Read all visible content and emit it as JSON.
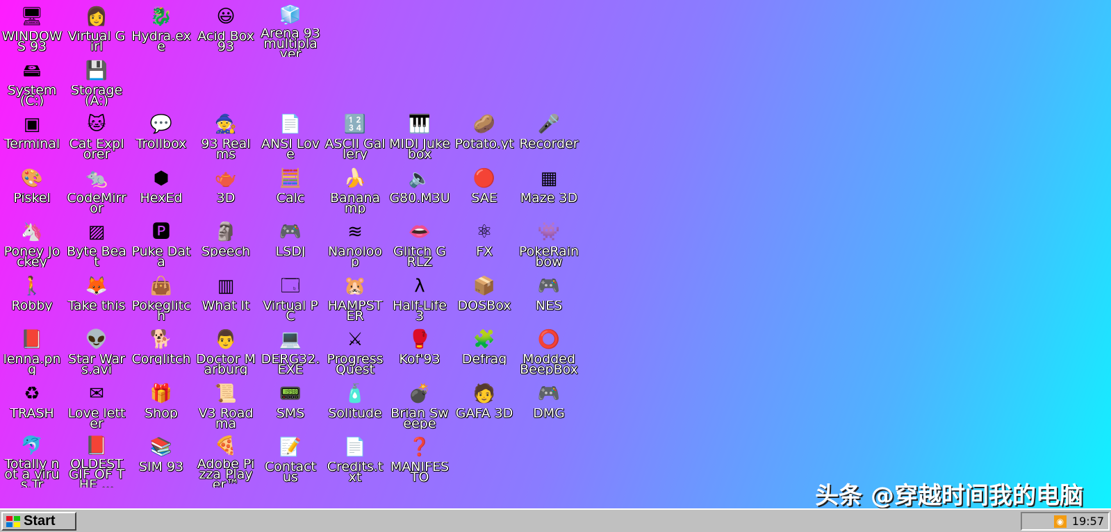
{
  "desktop": {
    "icons": [
      {
        "label": "WINDOWS 93",
        "glyph": "🖥",
        "icon": "computer-icon",
        "col": 0,
        "row": 0
      },
      {
        "label": "Virtual Girl",
        "glyph": "👩",
        "icon": "face-icon",
        "col": 1,
        "row": 0
      },
      {
        "label": "Hydra.exe",
        "glyph": "🐉",
        "icon": "dragon-icon",
        "col": 2,
        "row": 0
      },
      {
        "label": "Acid Box 93",
        "glyph": "😃",
        "icon": "smiley-icon",
        "col": 3,
        "row": 0
      },
      {
        "label": "Arena 93 multiplayer",
        "glyph": "🧊",
        "icon": "cube-icon",
        "col": 4,
        "row": 0
      },
      {
        "label": "System (C:)",
        "glyph": "🖴",
        "icon": "harddrive-icon",
        "col": 0,
        "row": 1
      },
      {
        "label": "Storage (A:)",
        "glyph": "💾",
        "icon": "floppy-drive-icon",
        "col": 1,
        "row": 1
      },
      {
        "label": "Terminal",
        "glyph": "▣",
        "icon": "terminal-icon",
        "col": 0,
        "row": 2
      },
      {
        "label": "Cat Explorer",
        "glyph": "🐱",
        "icon": "cat-globe-icon",
        "col": 1,
        "row": 2
      },
      {
        "label": "Trollbox",
        "glyph": "💬",
        "icon": "chat-icon",
        "col": 2,
        "row": 2
      },
      {
        "label": "93 Realms",
        "glyph": "🧙",
        "icon": "wizard-icon",
        "col": 3,
        "row": 2
      },
      {
        "label": "ANSI Love",
        "glyph": "📄",
        "icon": "ansi-document-icon",
        "col": 4,
        "row": 2
      },
      {
        "label": "ASCII Gallery",
        "glyph": "🔢",
        "icon": "numbers-icon",
        "col": 5,
        "row": 2
      },
      {
        "label": "MIDI Jukebox",
        "glyph": "🎹",
        "icon": "piano-icon",
        "col": 6,
        "row": 2
      },
      {
        "label": "Potato.yt",
        "glyph": "🥔",
        "icon": "potato-icon",
        "col": 7,
        "row": 2
      },
      {
        "label": "Recorder",
        "glyph": "🎤",
        "icon": "microphone-icon",
        "col": 8,
        "row": 2
      },
      {
        "label": "Piskel",
        "glyph": "🎨",
        "icon": "palette-icon",
        "col": 0,
        "row": 3
      },
      {
        "label": "CodeMirror",
        "glyph": "🐀",
        "icon": "rat-icon",
        "col": 1,
        "row": 3
      },
      {
        "label": "HexEd",
        "glyph": "⬢",
        "icon": "hex-cube-icon",
        "col": 2,
        "row": 3
      },
      {
        "label": "3D",
        "glyph": "🫖",
        "icon": "teapot-icon",
        "col": 3,
        "row": 3
      },
      {
        "label": "Calc",
        "glyph": "🧮",
        "icon": "calculator-icon",
        "col": 4,
        "row": 3
      },
      {
        "label": "Bananamp",
        "glyph": "🍌",
        "icon": "banana-icon",
        "col": 5,
        "row": 3
      },
      {
        "label": "G80.M3U",
        "glyph": "🔈",
        "icon": "audio-file-icon",
        "col": 6,
        "row": 3
      },
      {
        "label": "SAE",
        "glyph": "🔴",
        "icon": "amiga-ball-icon",
        "col": 7,
        "row": 3
      },
      {
        "label": "Maze 3D",
        "glyph": "▦",
        "icon": "maze-icon",
        "col": 8,
        "row": 3
      },
      {
        "label": "Poney Jockey",
        "glyph": "🦄",
        "icon": "pony-icon",
        "col": 0,
        "row": 4
      },
      {
        "label": "Byte Beat",
        "glyph": "▨",
        "icon": "bytebeat-icon",
        "col": 1,
        "row": 4
      },
      {
        "label": "Puke Data",
        "glyph": "🅿",
        "icon": "puke-data-icon",
        "col": 2,
        "row": 4
      },
      {
        "label": "Speech",
        "glyph": "🗿",
        "icon": "speech-face-icon",
        "col": 3,
        "row": 4
      },
      {
        "label": "LSDJ",
        "glyph": "🎮",
        "icon": "gameboy-icon",
        "col": 4,
        "row": 4
      },
      {
        "label": "Nanoloop",
        "glyph": "≋",
        "icon": "waveform-icon",
        "col": 5,
        "row": 4
      },
      {
        "label": "Glitch GRLZ",
        "glyph": "👄",
        "icon": "lips-icon",
        "col": 6,
        "row": 4
      },
      {
        "label": "FX",
        "glyph": "⚛",
        "icon": "atom-icon",
        "col": 7,
        "row": 4
      },
      {
        "label": "PokeRainbow",
        "glyph": "👾",
        "icon": "pixel-sprites-icon",
        "col": 8,
        "row": 4
      },
      {
        "label": "Robby",
        "glyph": "🚶",
        "icon": "stick-figure-icon",
        "col": 0,
        "row": 5
      },
      {
        "label": "Take this",
        "glyph": "🦊",
        "icon": "monkey-icon",
        "col": 1,
        "row": 5
      },
      {
        "label": "Pokeglitch",
        "glyph": "👜",
        "icon": "bag-icon",
        "col": 2,
        "row": 5
      },
      {
        "label": "What It",
        "glyph": "▥",
        "icon": "bars-icon",
        "col": 3,
        "row": 5
      },
      {
        "label": "Virtual PC",
        "glyph": "🗔",
        "icon": "window-icon",
        "col": 4,
        "row": 5
      },
      {
        "label": "HAMPSTER",
        "glyph": "🐹",
        "icon": "hamster-icon",
        "col": 5,
        "row": 5
      },
      {
        "label": "Half-Life 3",
        "glyph": "λ",
        "icon": "lambda-icon",
        "col": 6,
        "row": 5
      },
      {
        "label": "DOSBox",
        "glyph": "📦",
        "icon": "box-icon",
        "col": 7,
        "row": 5
      },
      {
        "label": "NES",
        "glyph": "🎮",
        "icon": "nes-console-icon",
        "col": 8,
        "row": 5
      },
      {
        "label": "lenna.png",
        "glyph": "📕",
        "icon": "image-file-icon",
        "col": 0,
        "row": 6
      },
      {
        "label": "Star Wars.avi",
        "glyph": "👽",
        "icon": "yoda-icon",
        "col": 1,
        "row": 6
      },
      {
        "label": "Corglitch",
        "glyph": "🐕",
        "icon": "corgi-icon",
        "col": 2,
        "row": 6
      },
      {
        "label": "Doctor Marburg",
        "glyph": "👨",
        "icon": "doctor-icon",
        "col": 3,
        "row": 6
      },
      {
        "label": "DERG32.EXE",
        "glyph": "💻",
        "icon": "derg-computer-icon",
        "col": 4,
        "row": 6
      },
      {
        "label": "Progress Quest",
        "glyph": "⚔",
        "icon": "swords-icon",
        "col": 5,
        "row": 6
      },
      {
        "label": "Kof'93",
        "glyph": "🥊",
        "icon": "fighter-icon",
        "col": 6,
        "row": 6
      },
      {
        "label": "Defrag",
        "glyph": "🧩",
        "icon": "defrag-icon",
        "col": 7,
        "row": 6
      },
      {
        "label": "Modded BeepBox",
        "glyph": "⭕",
        "icon": "ring-icon",
        "col": 8,
        "row": 6
      },
      {
        "label": "TRASH",
        "glyph": "♻",
        "icon": "trash-icon",
        "col": 0,
        "row": 7
      },
      {
        "label": "Love letter",
        "glyph": "✉",
        "icon": "envelope-icon",
        "col": 1,
        "row": 7
      },
      {
        "label": "Shop",
        "glyph": "🎁",
        "icon": "gift-icon",
        "col": 2,
        "row": 7
      },
      {
        "label": "V3 Roadma",
        "glyph": "📜",
        "icon": "scroll-icon",
        "col": 3,
        "row": 7
      },
      {
        "label": "SMS",
        "glyph": "📟",
        "icon": "sms-console-icon",
        "col": 4,
        "row": 7
      },
      {
        "label": "Solitude",
        "glyph": "🧴",
        "icon": "bottle-icon",
        "col": 5,
        "row": 7
      },
      {
        "label": "Brian Sweepe",
        "glyph": "💣",
        "icon": "mine-icon",
        "col": 6,
        "row": 7
      },
      {
        "label": "GAFA 3D",
        "glyph": "🧑",
        "icon": "guy-face-icon",
        "col": 7,
        "row": 7
      },
      {
        "label": "DMG",
        "glyph": "🎮",
        "icon": "dmg-console-icon",
        "col": 8,
        "row": 7
      },
      {
        "label": "Totally not a virus.Tr",
        "glyph": "🐬",
        "icon": "dolphin-shortcut-icon",
        "col": 0,
        "row": 8
      },
      {
        "label": "OLDEST GIF OF THE ...",
        "glyph": "📕",
        "icon": "gif-file-icon",
        "col": 1,
        "row": 8
      },
      {
        "label": "SIM 93",
        "glyph": "📚",
        "icon": "books-icon",
        "col": 2,
        "row": 8
      },
      {
        "label": "Adobe Pizza Player™",
        "glyph": "🍕",
        "icon": "pizza-icon",
        "col": 3,
        "row": 8
      },
      {
        "label": "Contact us",
        "glyph": "📝",
        "icon": "contact-icon",
        "col": 4,
        "row": 8
      },
      {
        "label": "Credits.txt",
        "glyph": "📄",
        "icon": "text-file-icon",
        "col": 5,
        "row": 8
      },
      {
        "label": "MANIFESTO",
        "glyph": "❓",
        "icon": "question-icon",
        "col": 6,
        "row": 8
      }
    ]
  },
  "watermark": "头条 @穿越时间我的电脑",
  "taskbar": {
    "start_label": "Start",
    "clock": "19:57",
    "tray_icon": "rss-icon"
  }
}
